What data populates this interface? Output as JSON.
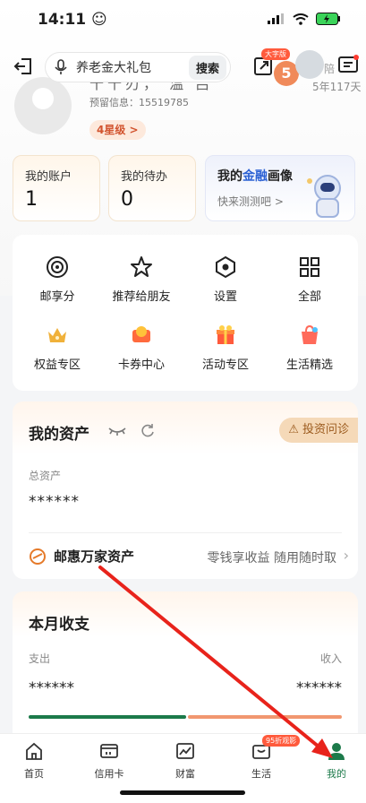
{
  "status_bar": {
    "time": "14:11 ☺"
  },
  "header": {
    "search_text": "养老金大礼包",
    "search_button": "搜索",
    "big_font_badge": "大字版",
    "level_number": "5",
    "days_top": "陪",
    "days_text": "5年117天"
  },
  "profile": {
    "name": "十十刃，  温 吕",
    "reserve_info": "预留信息：15519785",
    "star_level": "4星级 >"
  },
  "cards": {
    "account": {
      "title": "我的账户",
      "value": "1"
    },
    "todo": {
      "title": "我的待办",
      "value": "0"
    },
    "finance": {
      "title_pre": "我的",
      "title_hl": "金融",
      "title_post": "画像",
      "subtitle": "快来测测吧  >"
    }
  },
  "grid": {
    "items": [
      {
        "label": "邮享分",
        "icon": "target-icon"
      },
      {
        "label": "推荐给朋友",
        "icon": "star-icon"
      },
      {
        "label": "设置",
        "icon": "settings-icon"
      },
      {
        "label": "全部",
        "icon": "grid-icon"
      },
      {
        "label": "权益专区",
        "icon": "crown-icon"
      },
      {
        "label": "卡券中心",
        "icon": "coupon-icon"
      },
      {
        "label": "活动专区",
        "icon": "gift-icon"
      },
      {
        "label": "生活精选",
        "icon": "bag-icon"
      }
    ]
  },
  "assets": {
    "title": "我的资产",
    "invest_label": "投资问诊",
    "total_label": "总资产",
    "total_value": "******",
    "mh_title": "邮惠万家资产",
    "mh_desc": "零钱享收益 随用随时取",
    "chevron": "›"
  },
  "month": {
    "title": "本月收支",
    "expense_label": "支出",
    "income_label": "收入",
    "expense_value": "******",
    "income_value": "******"
  },
  "tabbar": {
    "badge": "95折观影",
    "tabs": [
      {
        "label": "首页"
      },
      {
        "label": "信用卡"
      },
      {
        "label": "财富"
      },
      {
        "label": "生活"
      },
      {
        "label": "我的"
      }
    ]
  },
  "colors": {
    "accent_green": "#1c7a4a",
    "arrow_red": "#e8231b"
  }
}
